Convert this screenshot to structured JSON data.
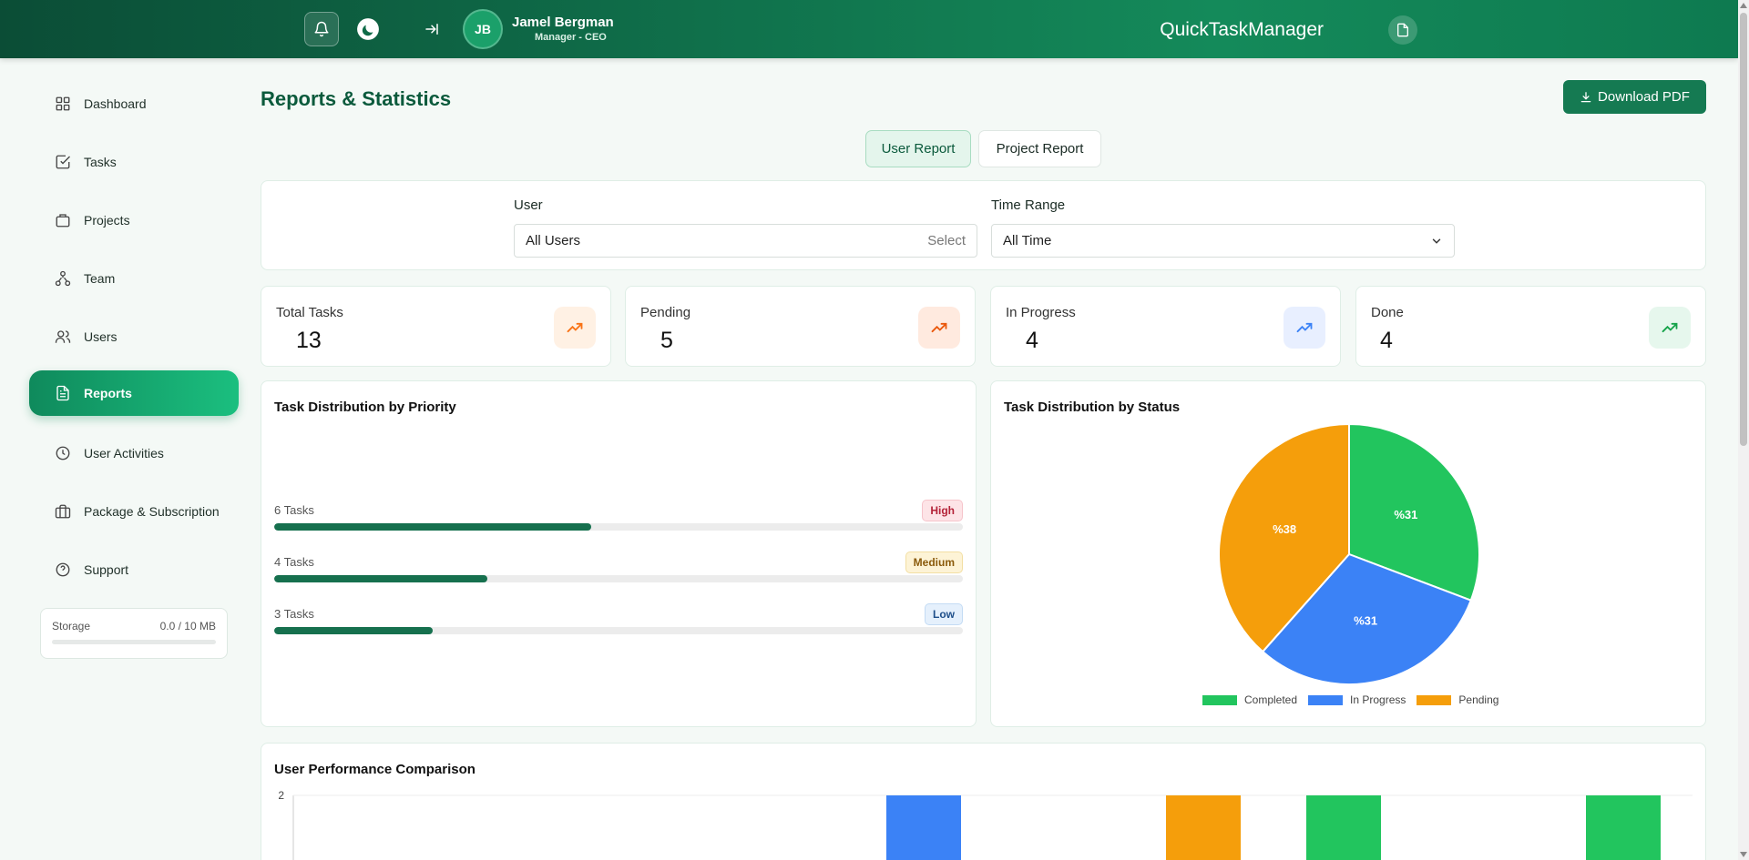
{
  "header": {
    "user_initials": "JB",
    "user_name": "Jamel Bergman",
    "user_role": "Manager - CEO",
    "app_title": "QuickTaskManager"
  },
  "sidebar": {
    "items": [
      {
        "label": "Dashboard",
        "icon": "grid-icon"
      },
      {
        "label": "Tasks",
        "icon": "checkbox-icon"
      },
      {
        "label": "Projects",
        "icon": "briefcase-icon"
      },
      {
        "label": "Team",
        "icon": "team-network-icon"
      },
      {
        "label": "Users",
        "icon": "users-icon"
      },
      {
        "label": "Reports",
        "icon": "document-icon"
      },
      {
        "label": "User Activities",
        "icon": "clock-icon"
      },
      {
        "label": "Package & Subscription",
        "icon": "package-icon"
      },
      {
        "label": "Support",
        "icon": "help-circle-icon"
      }
    ],
    "active": "Reports",
    "storage_label": "Storage",
    "storage_value": "0.0 / 10 MB",
    "storage_used_fraction": 0
  },
  "main": {
    "title": "Reports & Statistics",
    "download_label": "Download PDF",
    "tabs": [
      "User Report",
      "Project Report"
    ],
    "active_tab": "User Report",
    "filters": {
      "user_label": "User",
      "user_value": "All Users",
      "user_hint": "Select",
      "time_label": "Time Range",
      "time_value": "All Time"
    },
    "stats": [
      {
        "label": "Total Tasks",
        "value": "13",
        "color": "#f97316"
      },
      {
        "label": "Pending",
        "value": "5",
        "color": "#ea580c"
      },
      {
        "label": "In Progress",
        "value": "4",
        "color": "#3b82f6"
      },
      {
        "label": "Done",
        "value": "4",
        "color": "#16a34a"
      }
    ],
    "priority": {
      "title": "Task Distribution by Priority",
      "rows": [
        {
          "count": "6 Tasks",
          "badge": "High",
          "fraction": 0.46
        },
        {
          "count": "4 Tasks",
          "badge": "Medium",
          "fraction": 0.31
        },
        {
          "count": "3 Tasks",
          "badge": "Low",
          "fraction": 0.23
        }
      ]
    },
    "status_chart_title": "Task Distribution by Status",
    "performance_title": "User Performance Comparison"
  },
  "chart_data": [
    {
      "type": "pie",
      "title": "Task Distribution by Status",
      "categories": [
        "Completed",
        "In Progress",
        "Pending"
      ],
      "values": [
        4,
        4,
        5
      ],
      "labels": [
        "%31",
        "%31",
        "%38"
      ],
      "colors": [
        "#22c55e",
        "#3b82f6",
        "#f59e0b"
      ],
      "legend": "bottom"
    },
    {
      "type": "bar",
      "title": "User Performance Comparison",
      "ylim": [
        0,
        2
      ],
      "yticks": [
        "2"
      ],
      "bars": [
        {
          "series": "In Progress",
          "value": 2,
          "color": "#3b82f6"
        },
        {
          "series": "Pending",
          "value": 2,
          "color": "#f59e0b"
        },
        {
          "series": "Completed",
          "value": 2,
          "color": "#22c55e"
        },
        {
          "series": "Completed",
          "value": 2,
          "color": "#22c55e"
        }
      ]
    }
  ]
}
